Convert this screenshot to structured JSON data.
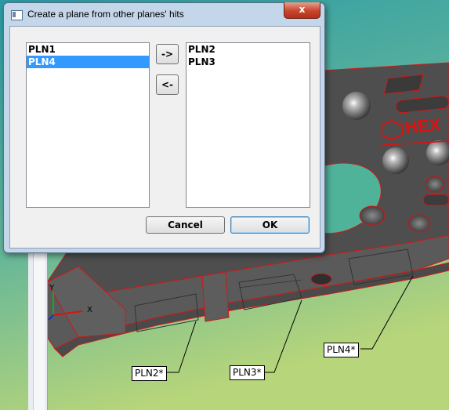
{
  "dialog": {
    "title": "Create a plane from other planes' hits",
    "close_glyph": "x",
    "left_list": [
      {
        "label": "PLN1",
        "selected": false
      },
      {
        "label": "PLN4",
        "selected": true
      }
    ],
    "right_list": [
      {
        "label": "PLN2"
      },
      {
        "label": "PLN3"
      }
    ],
    "move_right_label": "->",
    "move_left_label": "<-",
    "cancel_label": "Cancel",
    "ok_label": "OK"
  },
  "viewport": {
    "part_logo_text": "HEX",
    "axis_y_label": "Y",
    "axis_x_label": "X",
    "callouts": [
      "PLN2*",
      "PLN3*",
      "PLN4*"
    ]
  },
  "colors": {
    "selection": "#3399ff",
    "part_edge": "#e01010",
    "part_body": "#555555",
    "background_top": "#2f9ea0",
    "background_bottom": "#a8cf7a"
  }
}
